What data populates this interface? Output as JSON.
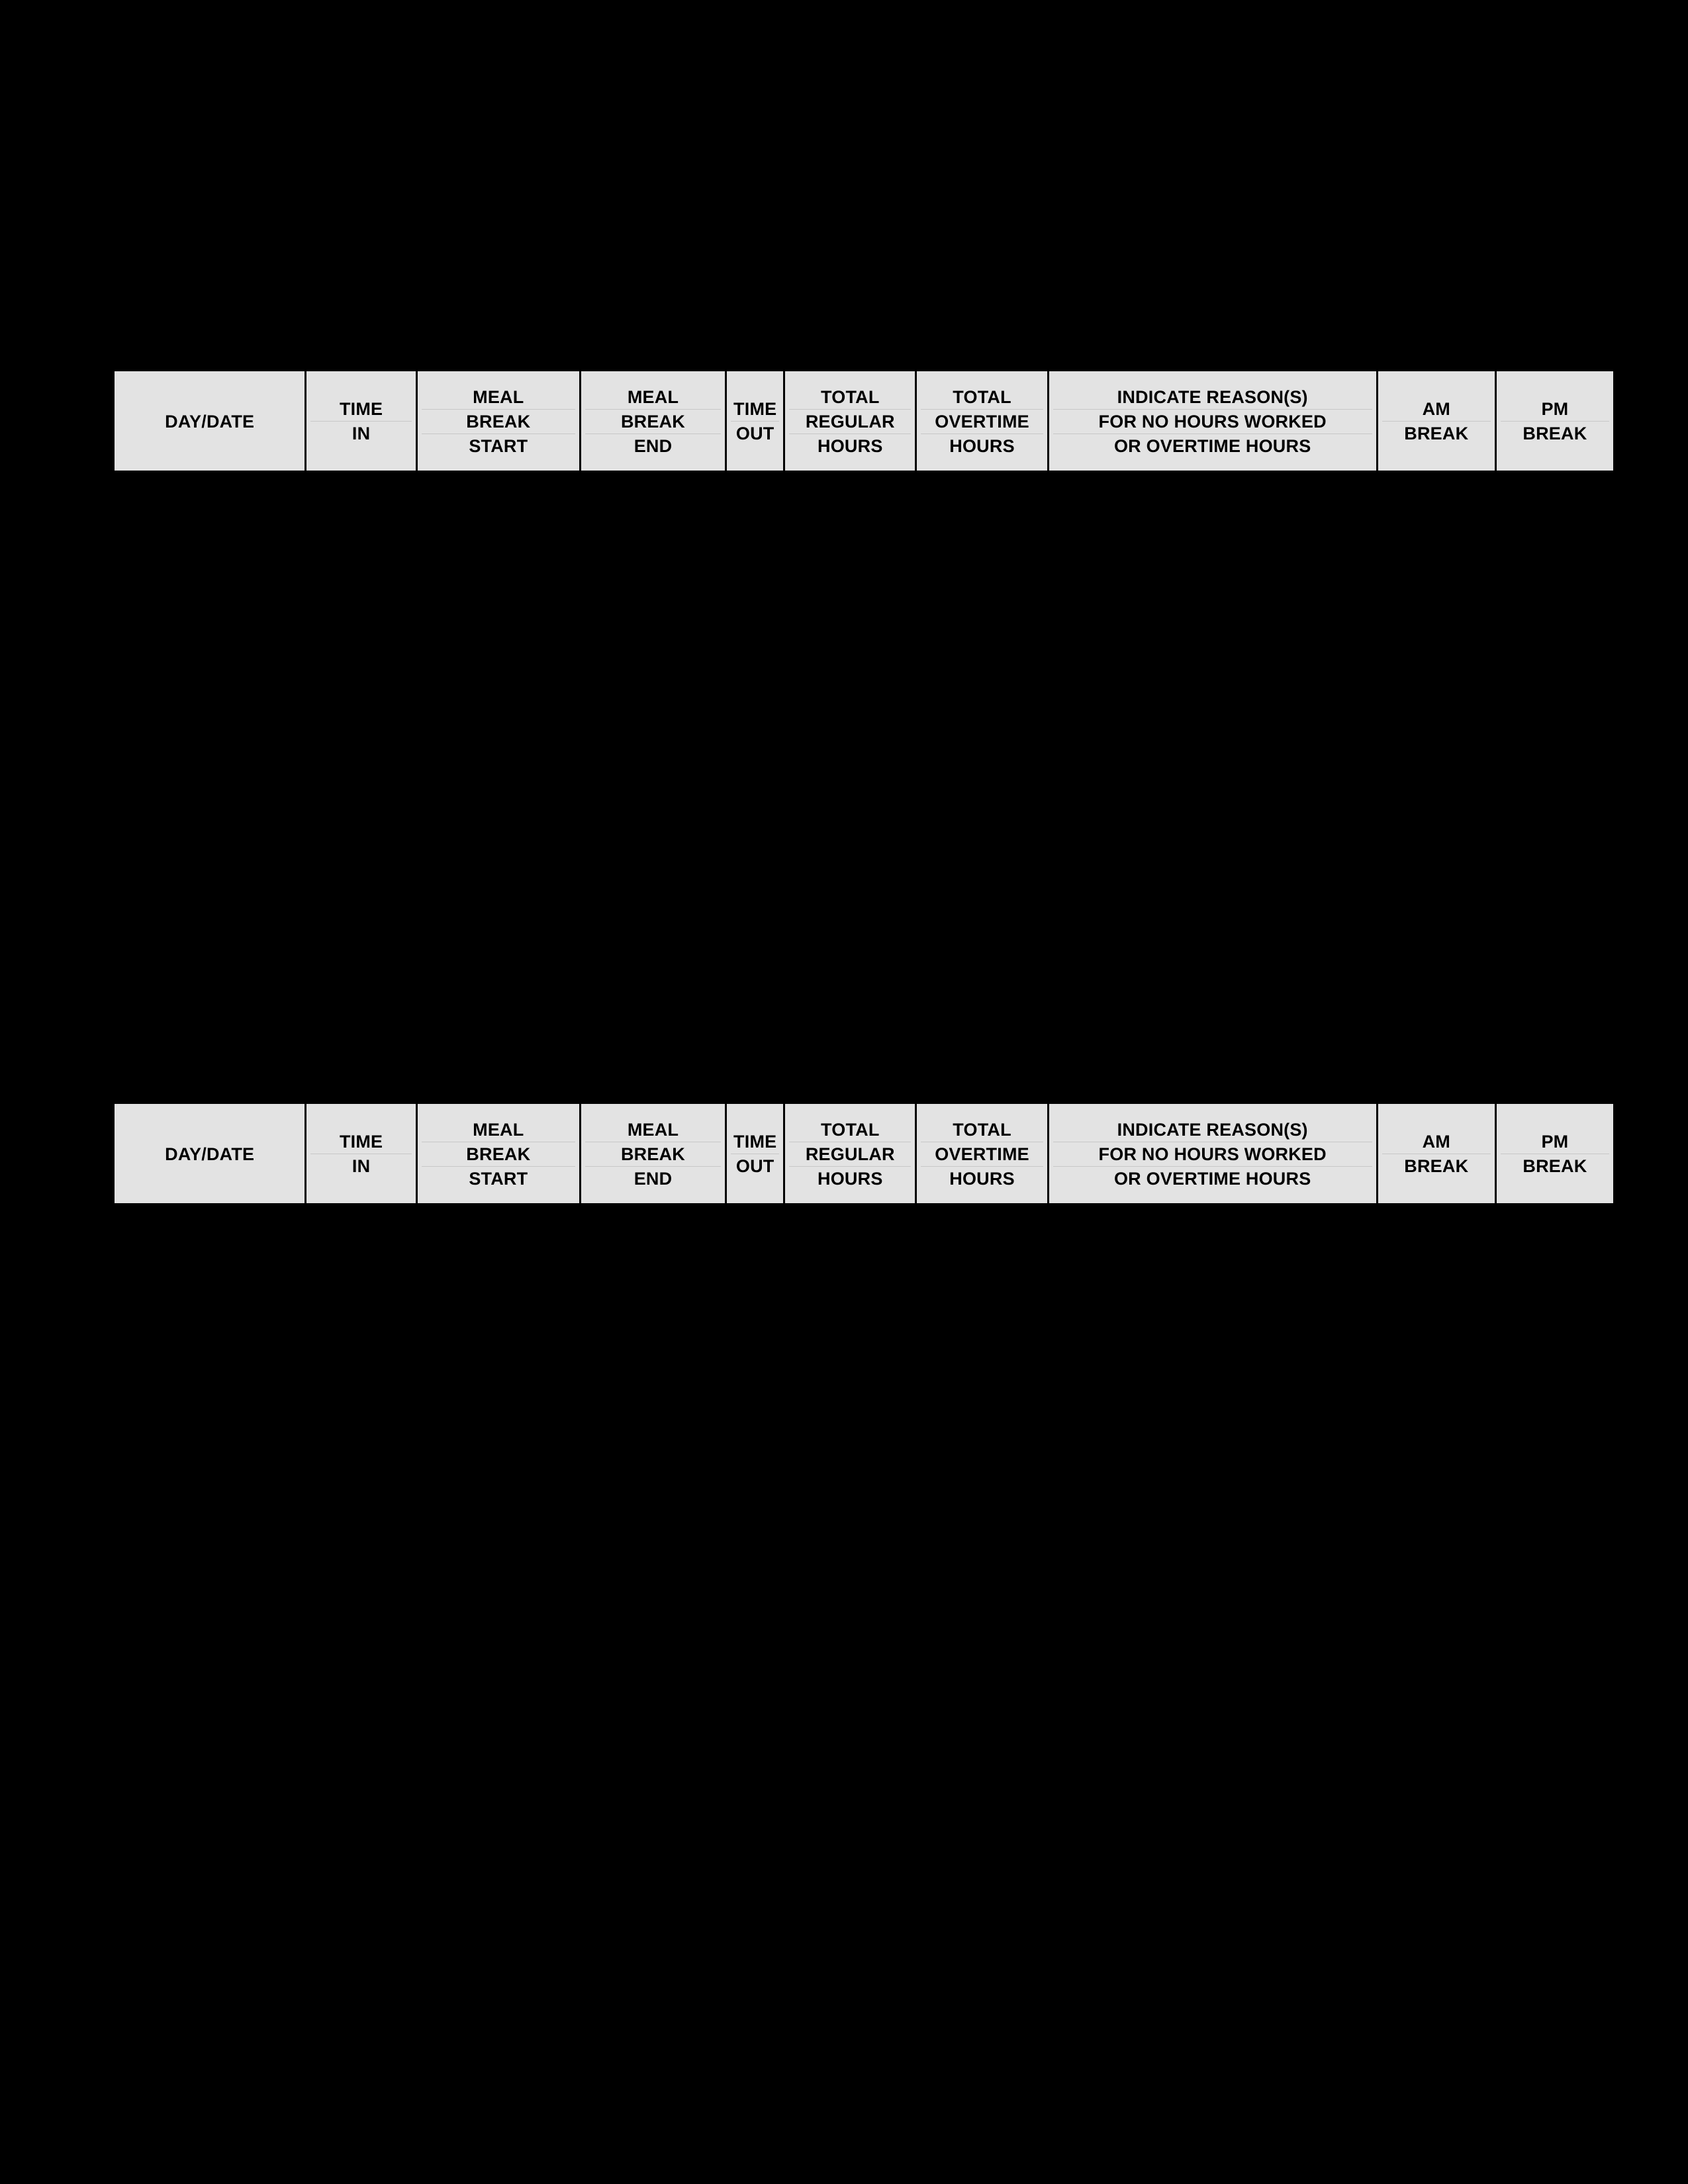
{
  "document": {
    "background_color": "#000000",
    "cell_background_color": "#e3e3e3",
    "border_color": "#000000",
    "rule_color": "#c8c8c8",
    "title": "Timesheet Header"
  },
  "columns": [
    {
      "key": "day_date",
      "lines": [
        "DAY/DATE"
      ]
    },
    {
      "key": "time_in",
      "lines": [
        "TIME",
        "IN"
      ]
    },
    {
      "key": "meal_break_start",
      "lines": [
        "MEAL",
        "BREAK",
        "START"
      ]
    },
    {
      "key": "meal_break_end",
      "lines": [
        "MEAL",
        "BREAK",
        "END"
      ]
    },
    {
      "key": "time_out",
      "lines": [
        "TIME",
        "OUT"
      ]
    },
    {
      "key": "total_regular_hours",
      "lines": [
        "TOTAL",
        "REGULAR",
        "HOURS"
      ]
    },
    {
      "key": "total_overtime_hours",
      "lines": [
        "TOTAL",
        "OVERTIME",
        "HOURS"
      ]
    },
    {
      "key": "reason",
      "lines": [
        "INDICATE REASON(S)",
        "FOR NO HOURS WORKED",
        "OR OVERTIME HOURS"
      ]
    },
    {
      "key": "am_break",
      "lines": [
        "AM",
        "BREAK"
      ]
    },
    {
      "key": "pm_break",
      "lines": [
        "PM",
        "BREAK"
      ]
    }
  ],
  "tables": [
    {
      "name": "timesheet-header-table-top",
      "headers": {
        "day_date": {
          "l1": "DAY/DATE"
        },
        "time_in": {
          "l1": "TIME",
          "l2": "IN"
        },
        "meal_break_start": {
          "l1": "MEAL",
          "l2": "BREAK",
          "l3": "START"
        },
        "meal_break_end": {
          "l1": "MEAL",
          "l2": "BREAK",
          "l3": "END"
        },
        "time_out": {
          "l1": "TIME",
          "l2": "OUT"
        },
        "total_regular_hours": {
          "l1": "TOTAL",
          "l2": "REGULAR",
          "l3": "HOURS"
        },
        "total_overtime_hours": {
          "l1": "TOTAL",
          "l2": "OVERTIME",
          "l3": "HOURS"
        },
        "reason": {
          "l1": "INDICATE REASON(S)",
          "l2": "FOR NO HOURS WORKED",
          "l3": "OR OVERTIME HOURS"
        },
        "am_break": {
          "l1": "AM",
          "l2": "BREAK"
        },
        "pm_break": {
          "l1": "PM",
          "l2": "BREAK"
        }
      }
    },
    {
      "name": "timesheet-header-table-bottom",
      "headers": {
        "day_date": {
          "l1": "DAY/DATE"
        },
        "time_in": {
          "l1": "TIME",
          "l2": "IN"
        },
        "meal_break_start": {
          "l1": "MEAL",
          "l2": "BREAK",
          "l3": "START"
        },
        "meal_break_end": {
          "l1": "MEAL",
          "l2": "BREAK",
          "l3": "END"
        },
        "time_out": {
          "l1": "TIME",
          "l2": "OUT"
        },
        "total_regular_hours": {
          "l1": "TOTAL",
          "l2": "REGULAR",
          "l3": "HOURS"
        },
        "total_overtime_hours": {
          "l1": "TOTAL",
          "l2": "OVERTIME",
          "l3": "HOURS"
        },
        "reason": {
          "l1": "INDICATE REASON(S)",
          "l2": "FOR NO HOURS WORKED",
          "l3": "OR OVERTIME HOURS"
        },
        "am_break": {
          "l1": "AM",
          "l2": "BREAK"
        },
        "pm_break": {
          "l1": "PM",
          "l2": "BREAK"
        }
      }
    }
  ]
}
